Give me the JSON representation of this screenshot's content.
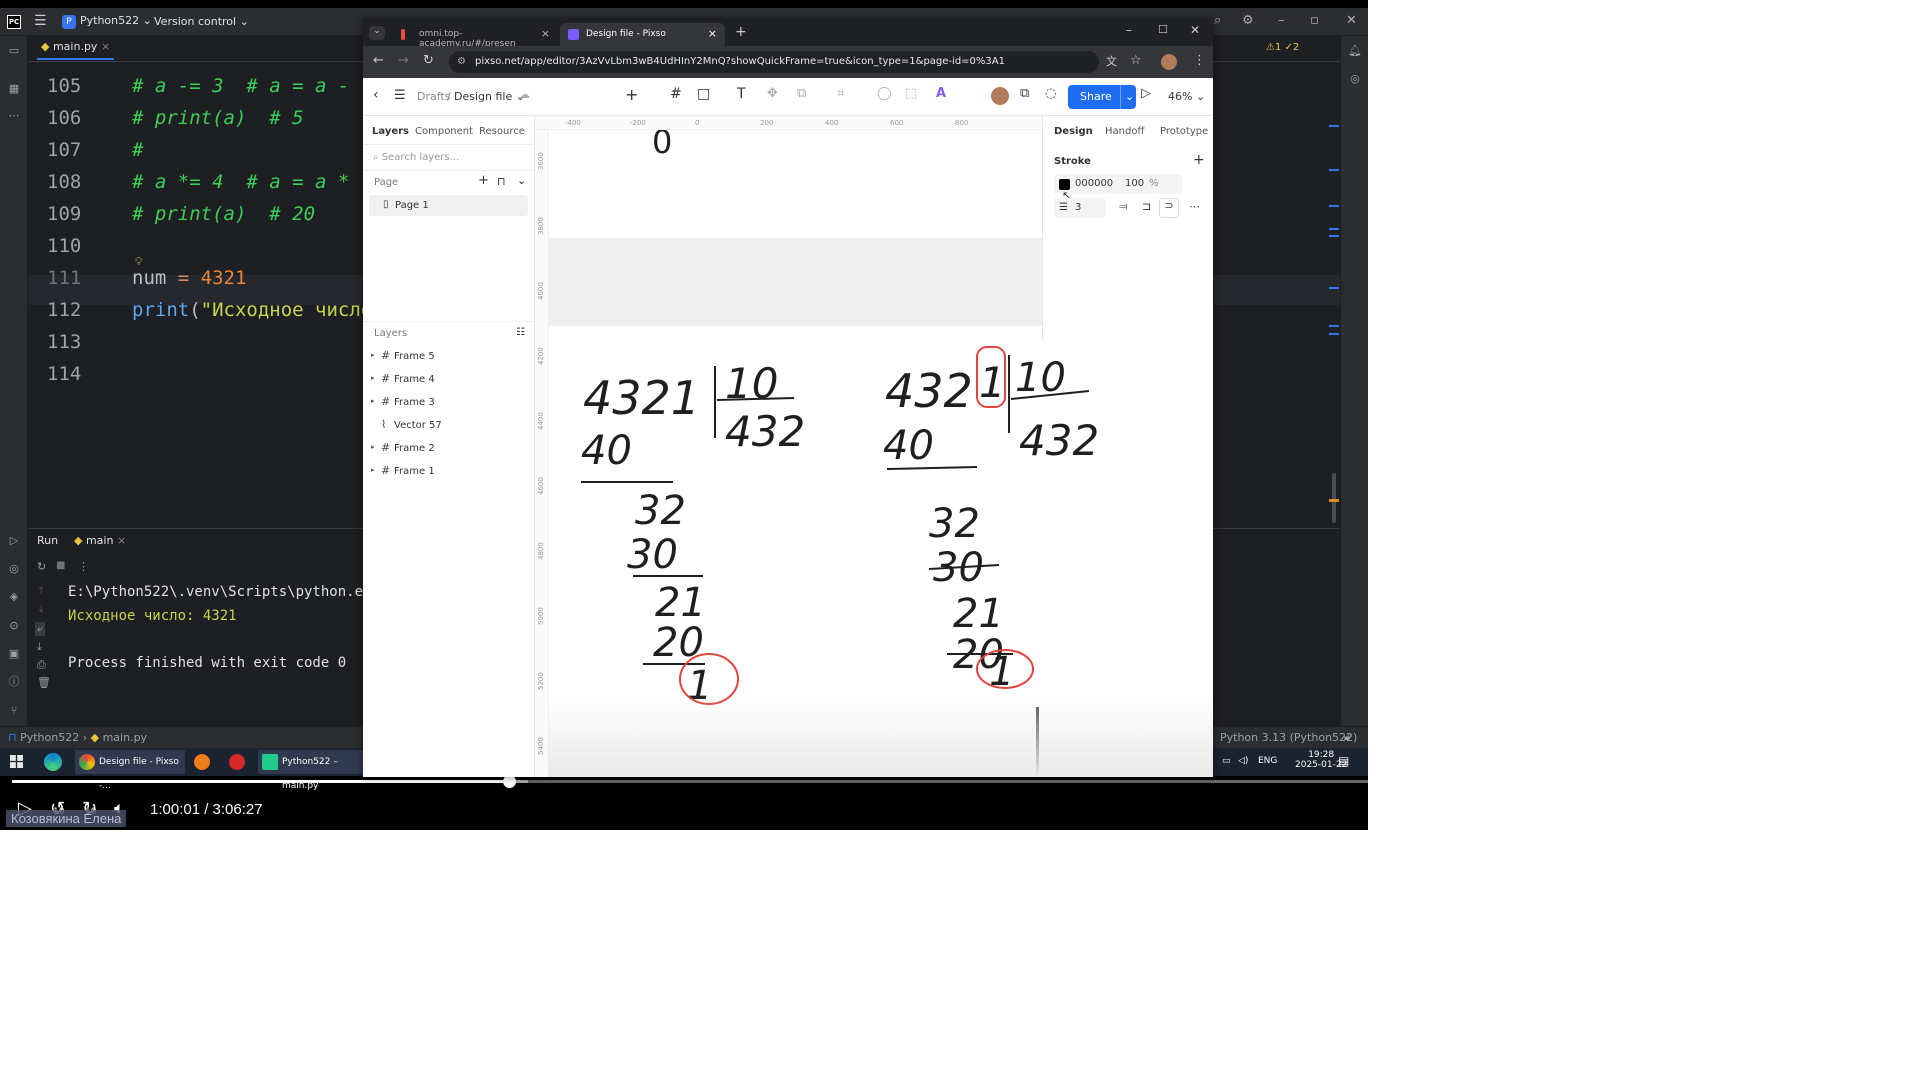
{
  "ide": {
    "project_badge": "P",
    "project_name": "Python522",
    "version_control": "Version control",
    "file_tab": "main.py",
    "lines": [
      {
        "num": "105",
        "code": "# a -= 3  # a = a - ",
        "kind": "comment"
      },
      {
        "num": "106",
        "code": "# print(a)  # 5",
        "kind": "comment"
      },
      {
        "num": "107",
        "code": "#",
        "kind": "comment"
      },
      {
        "num": "108",
        "code": "# a *= 4  # a = a * ",
        "kind": "comment"
      },
      {
        "num": "109",
        "code": "# print(a)  # 20",
        "kind": "comment"
      },
      {
        "num": "110",
        "code": "",
        "kind": "blank"
      },
      {
        "num": "111",
        "code": "",
        "kind": "assign"
      },
      {
        "num": "112",
        "code": "",
        "kind": "print"
      },
      {
        "num": "113",
        "code": "",
        "kind": "blank"
      },
      {
        "num": "114",
        "code": "",
        "kind": "blank"
      }
    ],
    "line111": {
      "var": "num",
      "op": " = ",
      "val": "4321"
    },
    "line112": {
      "fn": "print",
      "paren": "(",
      "str": "\"Исходное число"
    },
    "run_tab": "Run",
    "run_config": "main",
    "output": [
      "E:\\Python522\\.venv\\Scripts\\python.e",
      "Исходное число: 4321",
      "",
      "Process finished with exit code 0"
    ],
    "status_project": "Python522",
    "status_file": "main.py",
    "interpreter": "Python 3.13 (Python522)",
    "inspections": "⚠1 ✓2"
  },
  "taskbar": {
    "items": [
      {
        "label": "Design file - Pixso -...",
        "color": "#e8473d"
      },
      {
        "label": "",
        "color": "#f07c1b"
      },
      {
        "label": "",
        "color": "#d42a2a"
      },
      {
        "label": "Python522 – main.py",
        "color": "#21c98b"
      }
    ],
    "lang": "ENG",
    "time": "19:28",
    "date": "2025-01-22"
  },
  "video": {
    "time": "1:00:01 / 3:06:27",
    "presenter": "Козовякина Елена",
    "progress": 0.36,
    "skip_back": "10",
    "skip_fwd": "10"
  },
  "browser": {
    "tabs": [
      {
        "title": "omni.top-academy.ru/#/presen",
        "active": false
      },
      {
        "title": "Design file - Pixso",
        "active": true
      }
    ],
    "url": "pixso.net/app/editor/3AzVvLbm3wB4UdHInY2MnQ?showQuickFrame=true&icon_type=1&page-id=0%3A1"
  },
  "pixso": {
    "breadcrumb_root": "Drafts",
    "breadcrumb_sep": "/",
    "file_name": "Design file",
    "share_label": "Share",
    "zoom": "46%",
    "left_tabs": [
      "Layers",
      "Component",
      "Resource"
    ],
    "search_placeholder": "Search layers...",
    "page_section": "Page",
    "page_item": "Page 1",
    "layers_section": "Layers",
    "layers": [
      {
        "name": "Frame 5",
        "type": "frame"
      },
      {
        "name": "Frame 4",
        "type": "frame"
      },
      {
        "name": "Frame 3",
        "type": "frame"
      },
      {
        "name": "Vector 57",
        "type": "vector"
      },
      {
        "name": "Frame 2",
        "type": "frame"
      },
      {
        "name": "Frame 1",
        "type": "frame"
      }
    ],
    "right_tabs": [
      "Design",
      "Handoff",
      "Prototype"
    ],
    "stroke_title": "Stroke",
    "stroke_color": "000000",
    "stroke_opacity": "100",
    "stroke_unit": "%",
    "stroke_width": "3",
    "ruler_top": [
      "-400",
      "-200",
      "0",
      "200",
      "400",
      "600",
      "800"
    ],
    "ruler_left": [
      "3600",
      "3800",
      "4000",
      "4200",
      "4400",
      "4600",
      "4800",
      "5000",
      "5200",
      "5400"
    ],
    "left_division": {
      "dividend": "4321",
      "divisor": "10",
      "quotient": "432",
      "steps": [
        "40",
        "32",
        "30",
        "21",
        "20",
        "1"
      ]
    },
    "right_division": {
      "dividend_main": "432",
      "dividend_circled": "1",
      "divisor": "10",
      "quotient": "432",
      "steps": [
        "40",
        "32",
        "30",
        "21",
        "20",
        "1"
      ]
    },
    "fragment": "0"
  },
  "colors": {
    "accent": "#3574f0",
    "share_blue": "#1e6cf0",
    "ink": "#1f1f1f",
    "red_mark": "#e0453d"
  }
}
